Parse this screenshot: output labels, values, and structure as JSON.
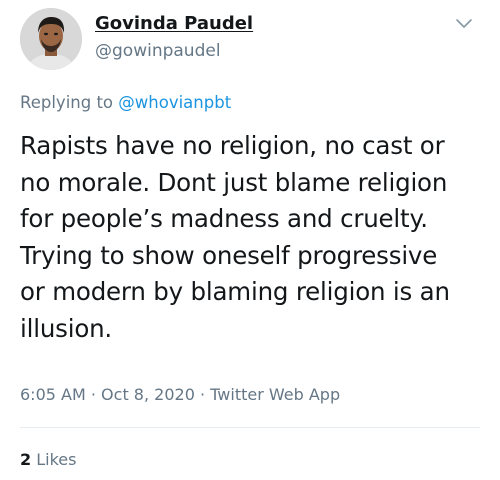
{
  "author": {
    "display_name": "Govinda Paudel",
    "handle": "@gowinpaudel"
  },
  "reply": {
    "prefix": "Replying to ",
    "mention": "@whovianpbt"
  },
  "tweet": {
    "lines": [
      "Rapists have no religion, no cast or",
      "no morale. Dont just blame religion",
      "for people’s madness and cruelty.",
      "Trying to show oneself progressive",
      "or modern by blaming religion is an",
      "illusion."
    ]
  },
  "meta": {
    "time": "6:05 AM",
    "separator": "·",
    "date": "Oct 8, 2020",
    "source": "Twitter Web App"
  },
  "stats": {
    "likes_count": "2",
    "likes_label": "Likes"
  },
  "icons": {
    "caret": "chevron-down-icon",
    "avatar": "avatar"
  },
  "colors": {
    "text": "#14171a",
    "secondary": "#657786",
    "link": "#1b95e0",
    "divider": "#e6ecf0"
  }
}
